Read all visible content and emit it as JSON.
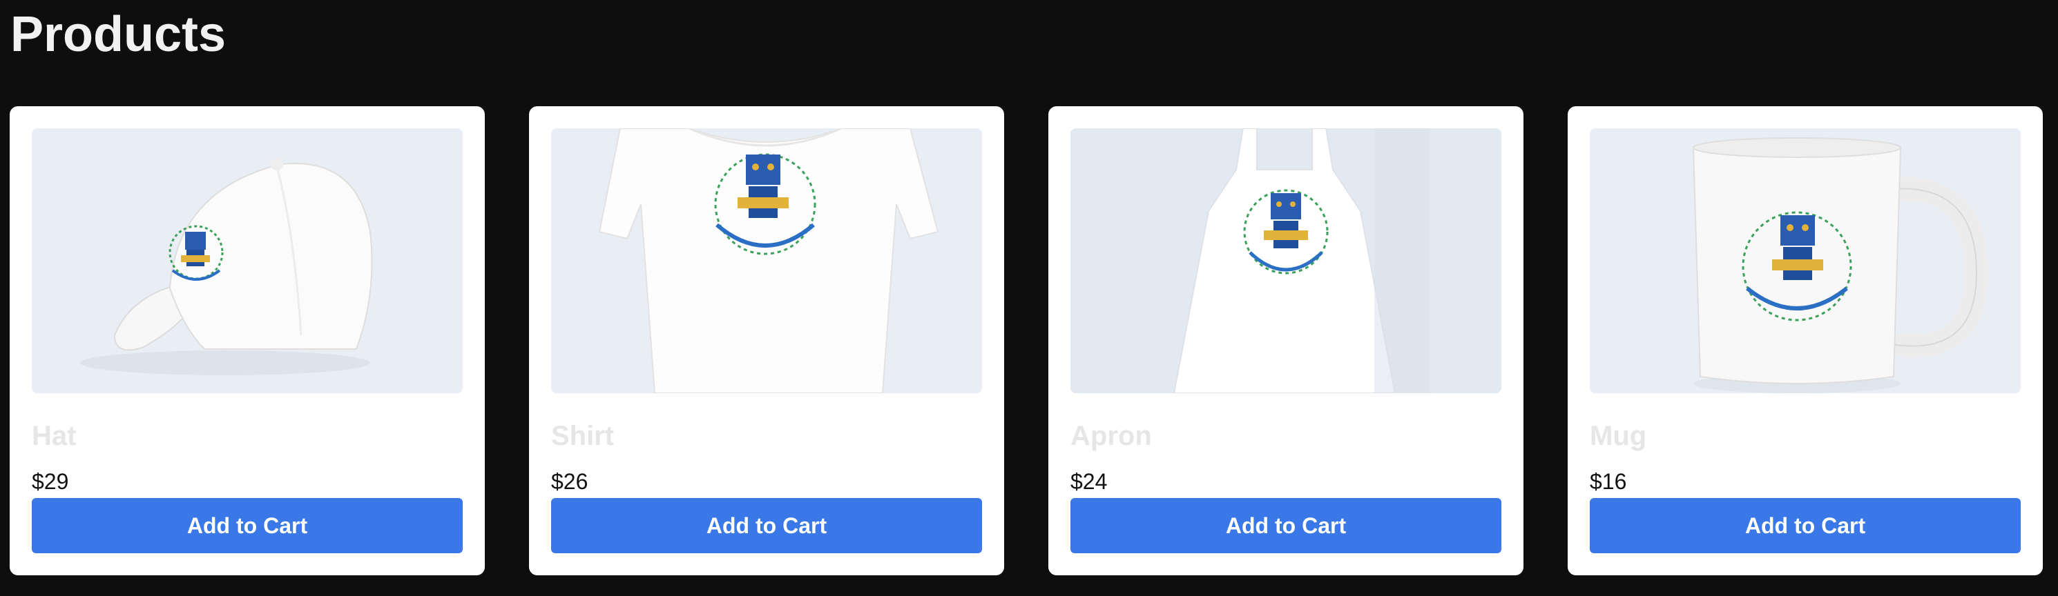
{
  "header": {
    "title": "Products"
  },
  "products": [
    {
      "name": "Hat",
      "price": "$29",
      "button": "Add to Cart",
      "icon": "hat-image"
    },
    {
      "name": "Shirt",
      "price": "$26",
      "button": "Add to Cart",
      "icon": "shirt-image"
    },
    {
      "name": "Apron",
      "price": "$24",
      "button": "Add to Cart",
      "icon": "apron-image"
    },
    {
      "name": "Mug",
      "price": "$16",
      "button": "Add to Cart",
      "icon": "mug-image"
    }
  ],
  "colors": {
    "background": "#0e0e0e",
    "card": "#ffffff",
    "button": "#3b78e7",
    "thumb": "#e9eef5"
  }
}
